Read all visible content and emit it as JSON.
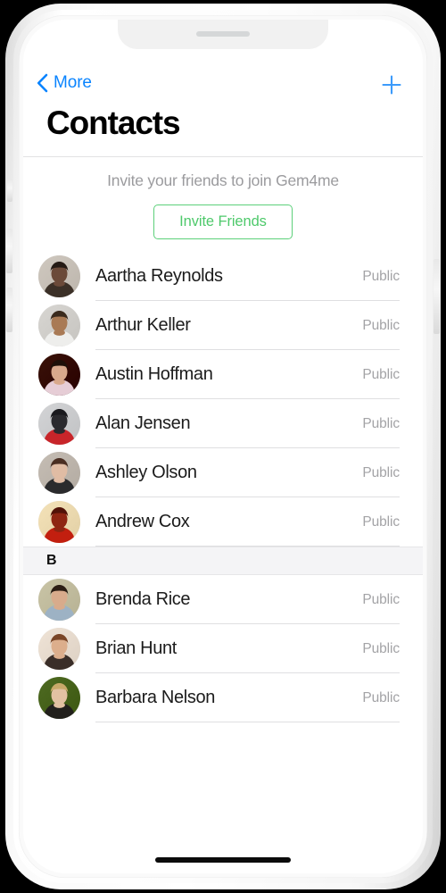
{
  "device": {
    "notch_label": "notch",
    "home_indicator_label": "home-indicator"
  },
  "nav": {
    "back_label": "More",
    "back_icon": "chevron-left-icon",
    "add_icon": "plus-icon",
    "title": "Contacts",
    "accent_color": "#0a84ff"
  },
  "invite": {
    "prompt": "Invite your friends to join Gem4me",
    "button_label": "Invite Friends",
    "button_color": "#4ec96b"
  },
  "sections": [
    {
      "letter": "",
      "show_header": false,
      "contacts": [
        {
          "name": "Aartha Reynolds",
          "status": "Public",
          "avatar": {
            "bg": "#cfc8bf",
            "skin": "#6b4a39",
            "hair": "#241a14",
            "cloth": "#3b3027"
          }
        },
        {
          "name": "Arthur Keller",
          "status": "Public",
          "avatar": {
            "bg": "#d8d6d2",
            "skin": "#a97a55",
            "hair": "#3a2a1d",
            "cloth": "#eeeeec"
          }
        },
        {
          "name": "Austin Hoffman",
          "status": "Public",
          "avatar": {
            "bg": "#3a1208",
            "skin": "#d8a98c",
            "hair": "#1e1008",
            "cloth": "#e6cdd6"
          }
        },
        {
          "name": "Alan Jensen",
          "status": "Public",
          "avatar": {
            "bg": "#d3d4d6",
            "skin": "#2a2a2e",
            "hair": "#1a1a1e",
            "cloth": "#c8252a"
          }
        },
        {
          "name": "Ashley Olson",
          "status": "Public",
          "avatar": {
            "bg": "#c5bdb4",
            "skin": "#e0bca4",
            "hair": "#4a2e22",
            "cloth": "#2b2b2d"
          }
        },
        {
          "name": "Andrew Cox",
          "status": "Public",
          "avatar": {
            "bg": "#f4e2b8",
            "skin": "#8e2512",
            "hair": "#521208",
            "cloth": "#c21f0f"
          }
        }
      ]
    },
    {
      "letter": "B",
      "show_header": true,
      "contacts": [
        {
          "name": "Brenda Rice",
          "status": "Public",
          "avatar": {
            "bg": "#c9c4a6",
            "skin": "#d8ab8c",
            "hair": "#2b1d14",
            "cloth": "#9db2c4"
          }
        },
        {
          "name": "Brian Hunt",
          "status": "Public",
          "avatar": {
            "bg": "#efe3d6",
            "skin": "#dcae8c",
            "hair": "#7a4526",
            "cloth": "#3a2e28"
          }
        },
        {
          "name": "Barbara Nelson",
          "status": "Public",
          "avatar": {
            "bg": "#4e6a22",
            "skin": "#e2c1a2",
            "hair": "#c9a96a",
            "cloth": "#22201c"
          }
        }
      ]
    }
  ]
}
